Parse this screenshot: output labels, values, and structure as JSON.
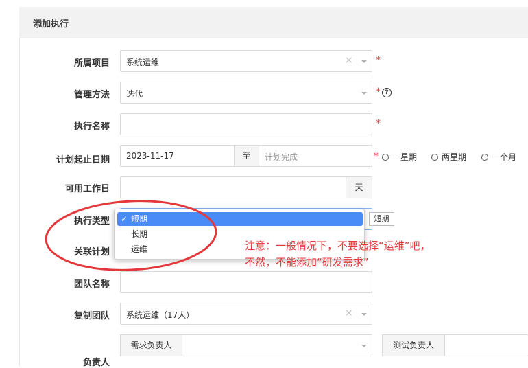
{
  "header": {
    "title": "添加执行"
  },
  "form": {
    "project": {
      "label": "所属项目",
      "value": "系统运维"
    },
    "method": {
      "label": "管理方法",
      "value": "迭代",
      "help": "?"
    },
    "name": {
      "label": "执行名称",
      "value": ""
    },
    "dates": {
      "label": "计划起止日期",
      "start": "2023-11-17",
      "sep": "至",
      "end_placeholder": "计划完成",
      "options": [
        "一星期",
        "两星期",
        "一个月"
      ]
    },
    "workdays": {
      "label": "可用工作日",
      "unit": "天"
    },
    "type": {
      "label": "执行类型",
      "options": [
        "短期",
        "长期",
        "运维"
      ],
      "selected": "短期",
      "tooltip": "短期"
    },
    "plan": {
      "label": "关联计划"
    },
    "team_name": {
      "label": "团队名称"
    },
    "copy_team": {
      "label": "复制团队",
      "value": "系统运维（17人）"
    },
    "owner": {
      "label": "负责人",
      "req_owner_addon": "需求负责人",
      "test_owner_addon": "测试负责人"
    }
  },
  "required_mark": "*",
  "clear_icon": "×",
  "annotation": {
    "line1": "注意：一般情况下，不要选择“运维”吧，",
    "line2": "不然，不能添加“研发需求”",
    "color": "#e4393c"
  }
}
